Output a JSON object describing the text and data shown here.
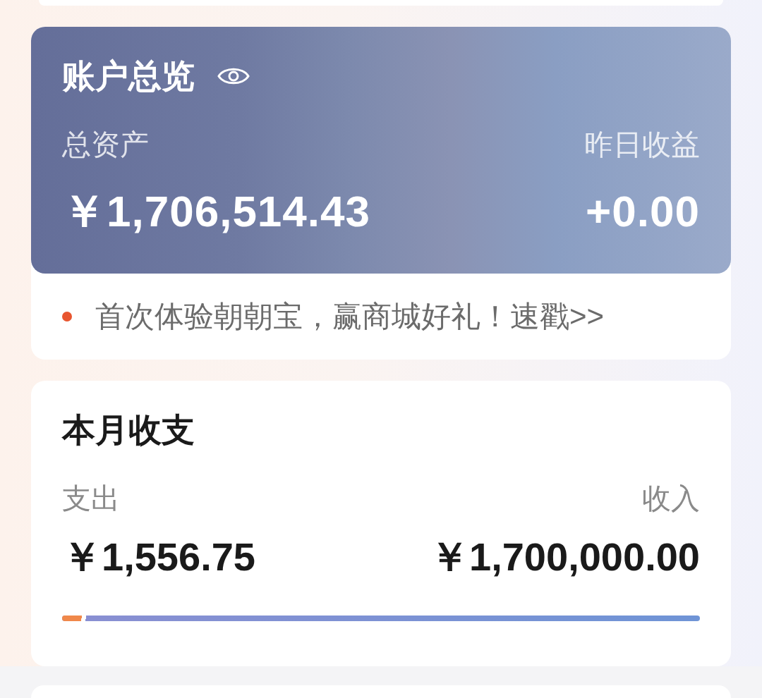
{
  "account_overview": {
    "title": "账户总览",
    "total_assets_label": "总资产",
    "total_assets": "￥1,706,514.43",
    "yesterday_earnings_label": "昨日收益",
    "yesterday_earnings": "+0.00"
  },
  "promo": {
    "text": "首次体验朝朝宝，赢商城好礼！速戳>>"
  },
  "monthly": {
    "title": "本月收支",
    "expense_label": "支出",
    "expense": "￥1,556.75",
    "income_label": "收入",
    "income": "￥1,700,000.00",
    "level": 0.03
  }
}
